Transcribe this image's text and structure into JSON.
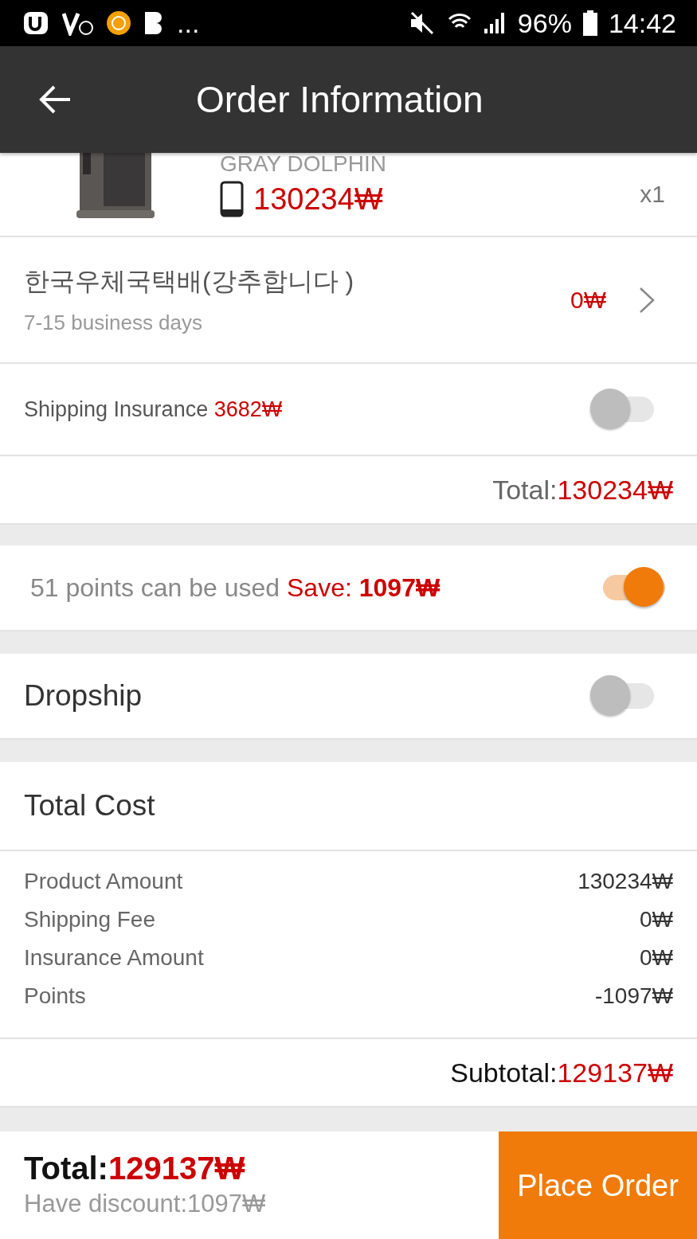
{
  "status_bar": {
    "more": "...",
    "battery": "96%",
    "time": "14:42"
  },
  "header": {
    "title": "Order Information"
  },
  "product": {
    "name": "GRAY DOLPHIN",
    "price": "130234₩",
    "quantity": "x1"
  },
  "shipping": {
    "method": "한국우체국택배(강추합니다 )",
    "duration": "7-15 business days",
    "fee": "0₩"
  },
  "insurance": {
    "label": "Shipping Insurance",
    "amount": "3682₩",
    "on": false
  },
  "order_total": {
    "label": "Total:",
    "value": "130234₩"
  },
  "points": {
    "text": "51 points can be used",
    "save_label": "Save:",
    "save_value": "1097₩",
    "on": true
  },
  "dropship": {
    "label": "Dropship",
    "on": false
  },
  "total_cost": {
    "title": "Total Cost",
    "lines": [
      {
        "label": "Product Amount",
        "value": "130234₩"
      },
      {
        "label": "Shipping Fee",
        "value": "0₩"
      },
      {
        "label": "Insurance Amount",
        "value": "0₩"
      },
      {
        "label": "Points",
        "value": "-1097₩"
      }
    ],
    "subtotal_label": "Subtotal:",
    "subtotal_value": "129137₩"
  },
  "footer": {
    "total_label": "Total:",
    "total_value": "129137₩",
    "discount": "Have discount:1097₩",
    "button": "Place Order"
  }
}
